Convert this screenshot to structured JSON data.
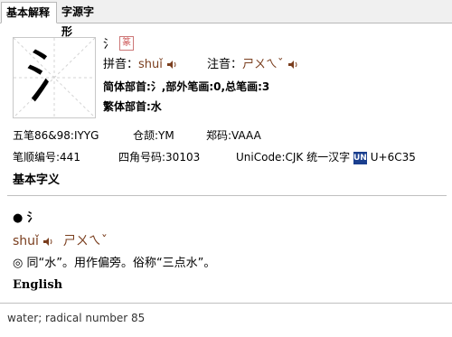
{
  "tabs": [
    "基本解释",
    "字源字形"
  ],
  "character": "氵",
  "glyph": "氵",
  "seal_label": "篆",
  "pinyin_label": "拼音：",
  "pinyin": "shuǐ",
  "zhuyin_label": "注音：",
  "zhuyin": "ㄕㄨㄟˇ",
  "radical_line": "简体部首:氵,部外笔画:0,总笔画:3",
  "traditional_radical": "繁体部首:水",
  "wubi": "五笔86&98:IYYG",
  "cangjie": "仓颉:YM",
  "zhengma": "郑码:VAAA",
  "stroke_number": "笔顺编号:441",
  "four_corner": "四角号码:30103",
  "unicode_label": "UniCode:CJK 统一汉字",
  "unicode_icon": "UN",
  "unicode_value": "U+6C35",
  "basic_meaning_title": "基本字义",
  "bullet": "●",
  "entry_char": "氵",
  "entry_pinyin": "shuǐ",
  "entry_zhuyin": "ㄕㄨㄟˇ",
  "definition": "◎ 同“水”。用作偏旁。俗称“三点水”。",
  "english_title": "English",
  "english_text": "water; radical number 85",
  "icons": {
    "speaker": "speaker-icon"
  },
  "colors": {
    "pinyin": "#7a3e1e",
    "border": "#c0c0c0",
    "unicode_icon": "#1a3f8f"
  }
}
